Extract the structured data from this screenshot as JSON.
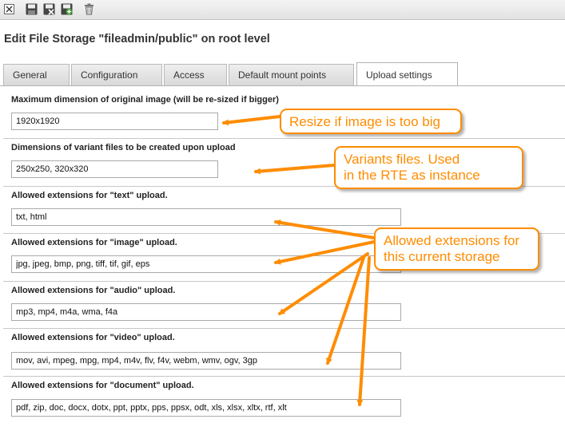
{
  "page": {
    "title": "Edit File Storage \"fileadmin/public\" on root level"
  },
  "toolbar": {
    "icons": [
      "close-icon",
      "save-icon",
      "save-and-close-icon",
      "save-and-new-icon",
      "delete-icon"
    ]
  },
  "tabs": [
    {
      "label": "General"
    },
    {
      "label": "Configuration"
    },
    {
      "label": "Access"
    },
    {
      "label": "Default mount points"
    },
    {
      "label": "Upload settings",
      "active": true
    }
  ],
  "fields": [
    {
      "label": "Maximum dimension of original image (will be re-sized if bigger)",
      "value": "1920x1920"
    },
    {
      "label": "Dimensions of variant files to be created upon upload",
      "value": "250x250, 320x320"
    },
    {
      "label": "Allowed extensions for \"text\" upload.",
      "value": "txt, html"
    },
    {
      "label": "Allowed extensions for \"image\" upload.",
      "value": "jpg, jpeg, bmp, png, tiff, tif, gif, eps"
    },
    {
      "label": "Allowed extensions for \"audio\" upload.",
      "value": "mp3, mp4, m4a, wma, f4a"
    },
    {
      "label": "Allowed extensions for \"video\" upload.",
      "value": "mov, avi, mpeg, mpg, mp4, m4v, flv, f4v, webm, wmv, ogv, 3gp"
    },
    {
      "label": "Allowed extensions for \"document\" upload.",
      "value": "pdf, zip, doc, docx, dotx, ppt, pptx, pps, ppsx, odt, xls, xlsx, xltx, rtf, xlt"
    }
  ],
  "annotations": {
    "resize": {
      "line1": "Resize if image is too big"
    },
    "variants": {
      "line1": "Variants files. Used",
      "line2": "in the RTE as instance"
    },
    "extensions": {
      "line1": "Allowed extensions for",
      "line2": "this current storage"
    },
    "color": "#ff8c00"
  }
}
